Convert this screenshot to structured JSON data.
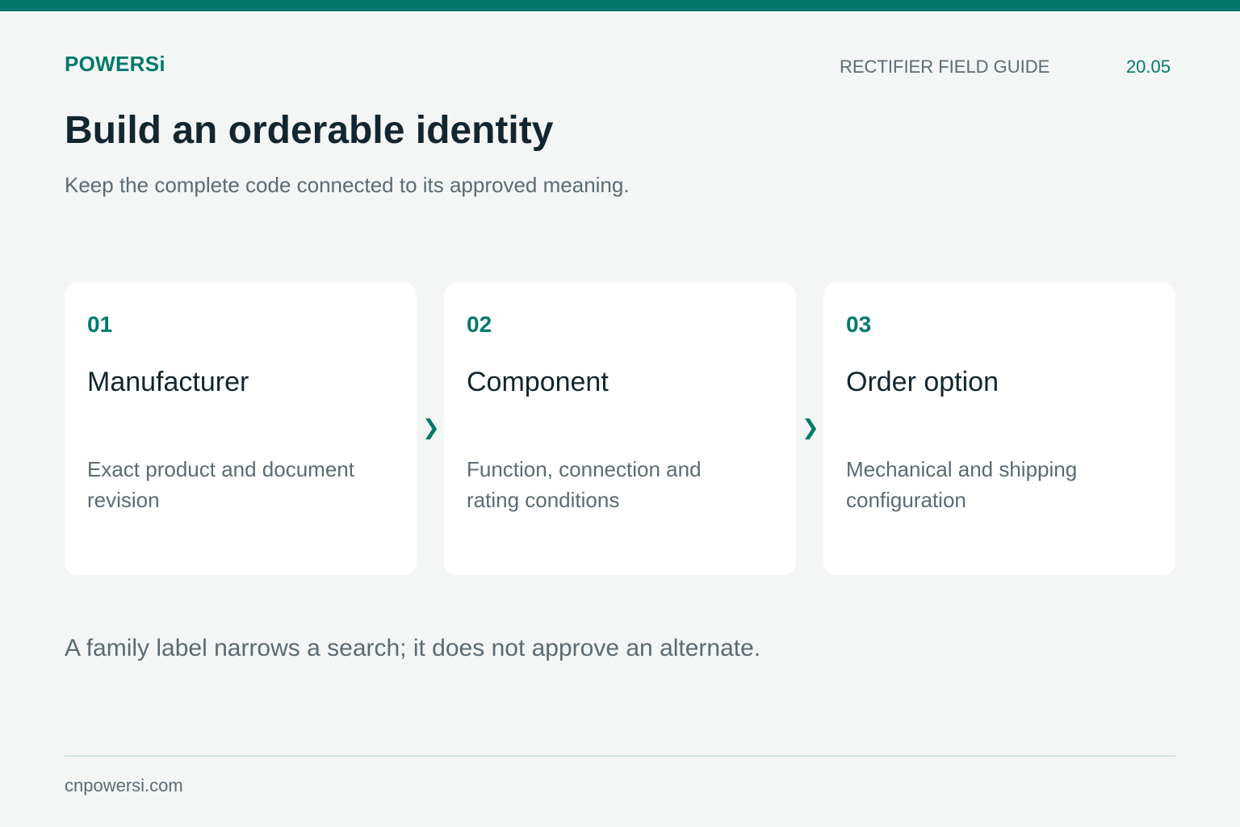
{
  "header": {
    "brand": "POWERSi",
    "guide_name": "RECTIFIER FIELD GUIDE",
    "page_number": "20.05"
  },
  "main": {
    "title": "Build an orderable identity",
    "subtitle": "Keep the complete code connected to its approved meaning.",
    "steps": [
      {
        "number": "01",
        "heading": "Manufacturer",
        "description": "Exact product and document revision"
      },
      {
        "number": "02",
        "heading": "Component",
        "description": "Function, connection and rating conditions"
      },
      {
        "number": "03",
        "heading": "Order option",
        "description": "Mechanical and shipping configuration"
      }
    ],
    "arrow_glyph": "❯",
    "note": "A family label narrows a search; it does not approve an alternate."
  },
  "footer": {
    "url": "cnpowersi.com"
  },
  "colors": {
    "accent": "#00796b",
    "background": "#f4f6f5",
    "card": "#ffffff",
    "heading_text": "#13262f",
    "muted_text": "#5b6b72",
    "divider": "#cfe0db"
  }
}
